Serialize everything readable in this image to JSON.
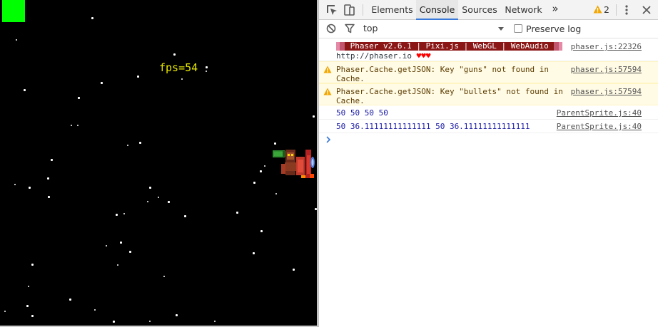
{
  "game": {
    "fps_label": "fps=54",
    "colors": {
      "background": "#000000",
      "health_box": "#00ff00",
      "fps_text": "#e8e800"
    }
  },
  "devtools": {
    "toolbar": {
      "inspect_icon": "inspect-element-icon",
      "device_icon": "device-toolbar-icon",
      "tabs": [
        {
          "label": "Elements",
          "active": false
        },
        {
          "label": "Console",
          "active": true
        },
        {
          "label": "Sources",
          "active": false
        },
        {
          "label": "Network",
          "active": false
        }
      ],
      "more_tabs_glyph": "»",
      "warning_count": "2",
      "menu_icon": "kebab-menu-icon",
      "close_icon": "close-icon"
    },
    "filterbar": {
      "clear_icon": "clear-console-icon",
      "filter_icon": "filter-icon",
      "context": "top",
      "preserve_log_label": "Preserve log",
      "preserve_log_checked": false
    },
    "console": {
      "messages": [
        {
          "level": "log",
          "banner_text": " Phaser v2.6.1 | Pixi.js | WebGL | WebAudio ",
          "line2": "http://phaser.io ",
          "hearts": "♥♥♥",
          "source": "phaser.js:22326"
        },
        {
          "level": "warning",
          "line1": "Phaser.Cache.getJSON: Key \"guns\" not found in",
          "line2": "Cache.",
          "source": "phaser.js:57594"
        },
        {
          "level": "warning",
          "line1": "Phaser.Cache.getJSON: Key \"bullets\" not found in",
          "line2": "Cache.",
          "source": "phaser.js:57594"
        },
        {
          "level": "log",
          "text": "50 50 50 50",
          "source": "ParentSprite.js:40"
        },
        {
          "level": "log",
          "text": "50 36.11111111111111 50 36.11111111111111",
          "source": "ParentSprite.js:40"
        }
      ],
      "prompt_glyph": "›"
    }
  }
}
